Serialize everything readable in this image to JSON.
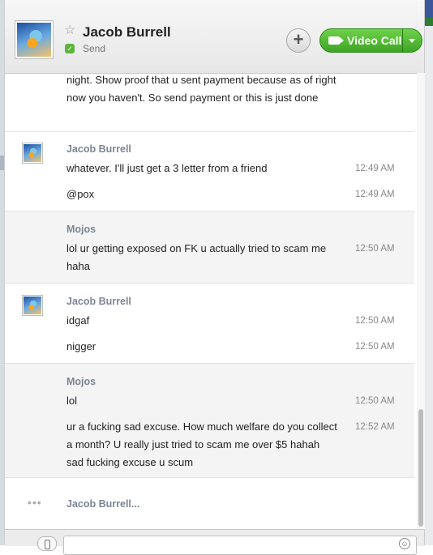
{
  "header": {
    "contact_name": "Jacob Burrell",
    "status": "Send",
    "video_call_label": "Video Call",
    "plus_label": "+",
    "star": "☆",
    "status_icon": "✓"
  },
  "messages": [
    {
      "sender": "",
      "lines": [
        {
          "text": "night. Show proof that u sent payment because as of right now you haven't. So send payment or this is just done",
          "time": ""
        }
      ]
    },
    {
      "sender": "Jacob Burrell",
      "lines": [
        {
          "text": "whatever. I'll just get a 3 letter from a friend",
          "time": "12:49 AM"
        },
        {
          "text": "@pox",
          "time": "12:49 AM"
        }
      ]
    },
    {
      "sender": "Mojos",
      "lines": [
        {
          "text": "lol ur getting exposed on FK u actually tried to scam me haha",
          "time": "12:50 AM"
        }
      ]
    },
    {
      "sender": "Jacob Burrell",
      "lines": [
        {
          "text": "idgaf",
          "time": "12:50 AM"
        },
        {
          "text": "nigger",
          "time": "12:50 AM"
        }
      ]
    },
    {
      "sender": "Mojos",
      "lines": [
        {
          "text": "lol",
          "time": "12:50 AM"
        },
        {
          "text": "ur a fucking sad excuse. How much welfare do you collect a month? U really just tried to scam me over $5 hahah sad fucking excuse u scum",
          "time": "12:52 AM"
        }
      ]
    }
  ],
  "typing": {
    "dots": "•••",
    "text": "Jacob Burrell..."
  },
  "composer": {
    "placeholder": "",
    "emoji": "☺"
  },
  "colors": {
    "accent_green": "#4cbf2e",
    "sender_gray": "#7d8594"
  }
}
